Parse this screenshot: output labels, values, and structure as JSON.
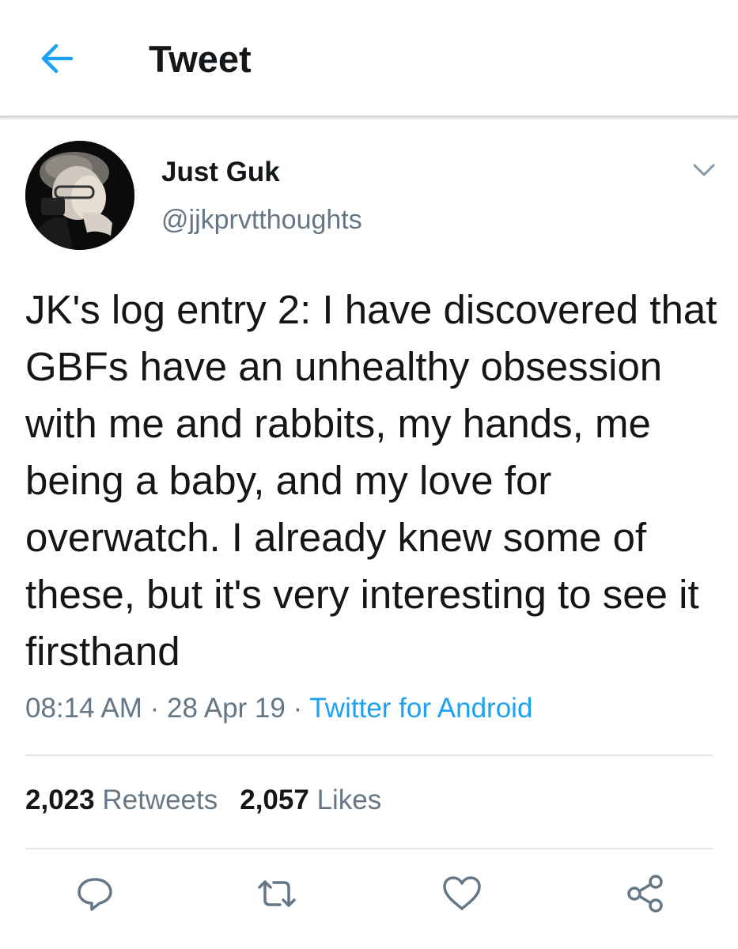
{
  "header": {
    "back_icon": "arrow-left-icon",
    "title": "Tweet"
  },
  "tweet": {
    "author": {
      "display_name": "Just Guk",
      "handle": "@jjkprvtthoughts"
    },
    "text": "JK's log entry 2: I have discovered that GBFs have an unhealthy obsession with me and rabbits, my hands, me being a baby, and my love for overwatch. I already knew some of these, but it's very interesting to see it firsthand",
    "time": "08:14 AM",
    "date": "28 Apr 19",
    "separator": "·",
    "source": "Twitter for Android",
    "stats": {
      "retweets_count": "2,023",
      "retweets_label": "Retweets",
      "likes_count": "2,057",
      "likes_label": "Likes"
    },
    "actions": [
      "reply-icon",
      "retweet-icon",
      "like-icon",
      "share-icon"
    ]
  },
  "colors": {
    "accent": "#1da1f2",
    "text": "#14171a",
    "secondary_text": "#657786",
    "divider": "#e1e8ed"
  }
}
